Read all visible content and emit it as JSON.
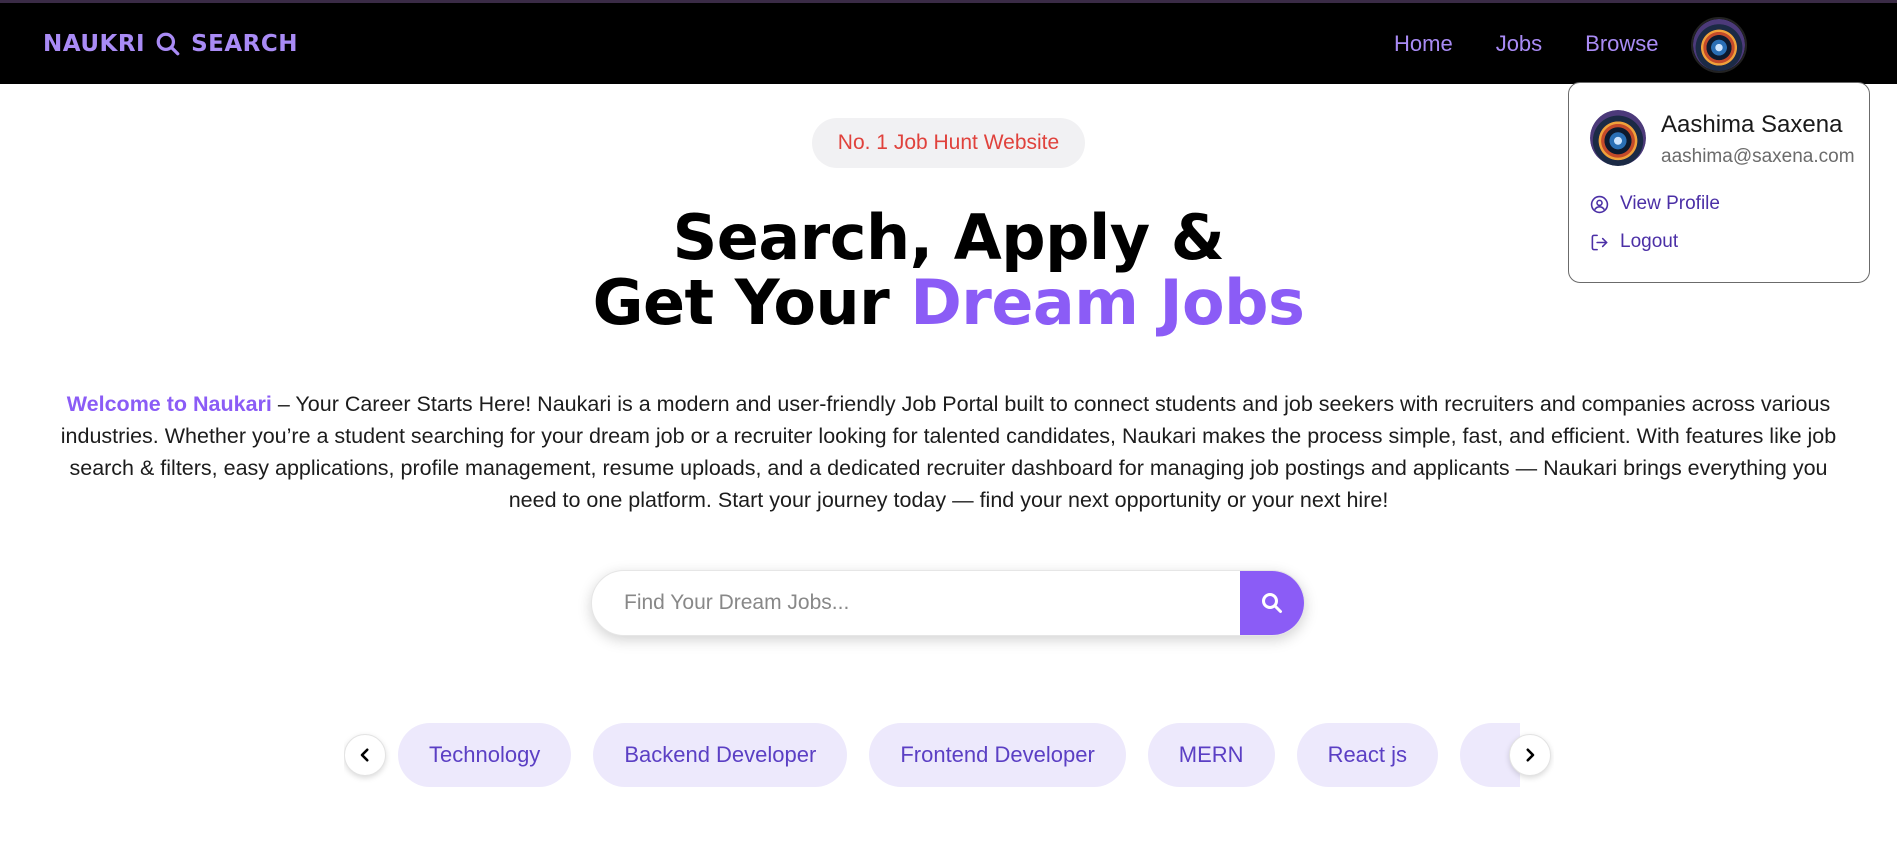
{
  "nav": {
    "brand_left": "NAUKRI",
    "brand_right": "SEARCH",
    "links": [
      "Home",
      "Jobs",
      "Browse"
    ],
    "brand_color": "#a98bf5",
    "background": "#000000"
  },
  "profile_menu": {
    "name": "Aashima Saxena",
    "email": "aashima@saxena.com",
    "view_profile": "View Profile",
    "logout": "Logout"
  },
  "hero": {
    "badge": "No. 1 Job Hunt Website",
    "line1": "Search, Apply &",
    "line2_prefix": "Get Your",
    "line2_accent": "Dream Jobs",
    "accent_color": "#8b5cf6"
  },
  "description": {
    "lead": "Welcome to Naukari",
    "body": " – Your Career Starts Here! Naukari is a modern and user-friendly Job Portal built to connect students and job seekers with recruiters and companies across various industries. Whether you’re a student searching for your dream job or a recruiter looking for talented candidates, Naukari makes the process simple, fast, and efficient. With features like job search & filters, easy applications, profile management, resume uploads, and a dedicated recruiter dashboard for managing job postings and applicants — Naukari brings everything you need to one platform. Start your journey today — find your next opportunity or your next hire!"
  },
  "search": {
    "placeholder": "Find Your Dream Jobs...",
    "value": ""
  },
  "categories": [
    "Technology",
    "Backend Developer",
    "Frontend Developer",
    "MERN",
    "React js"
  ]
}
